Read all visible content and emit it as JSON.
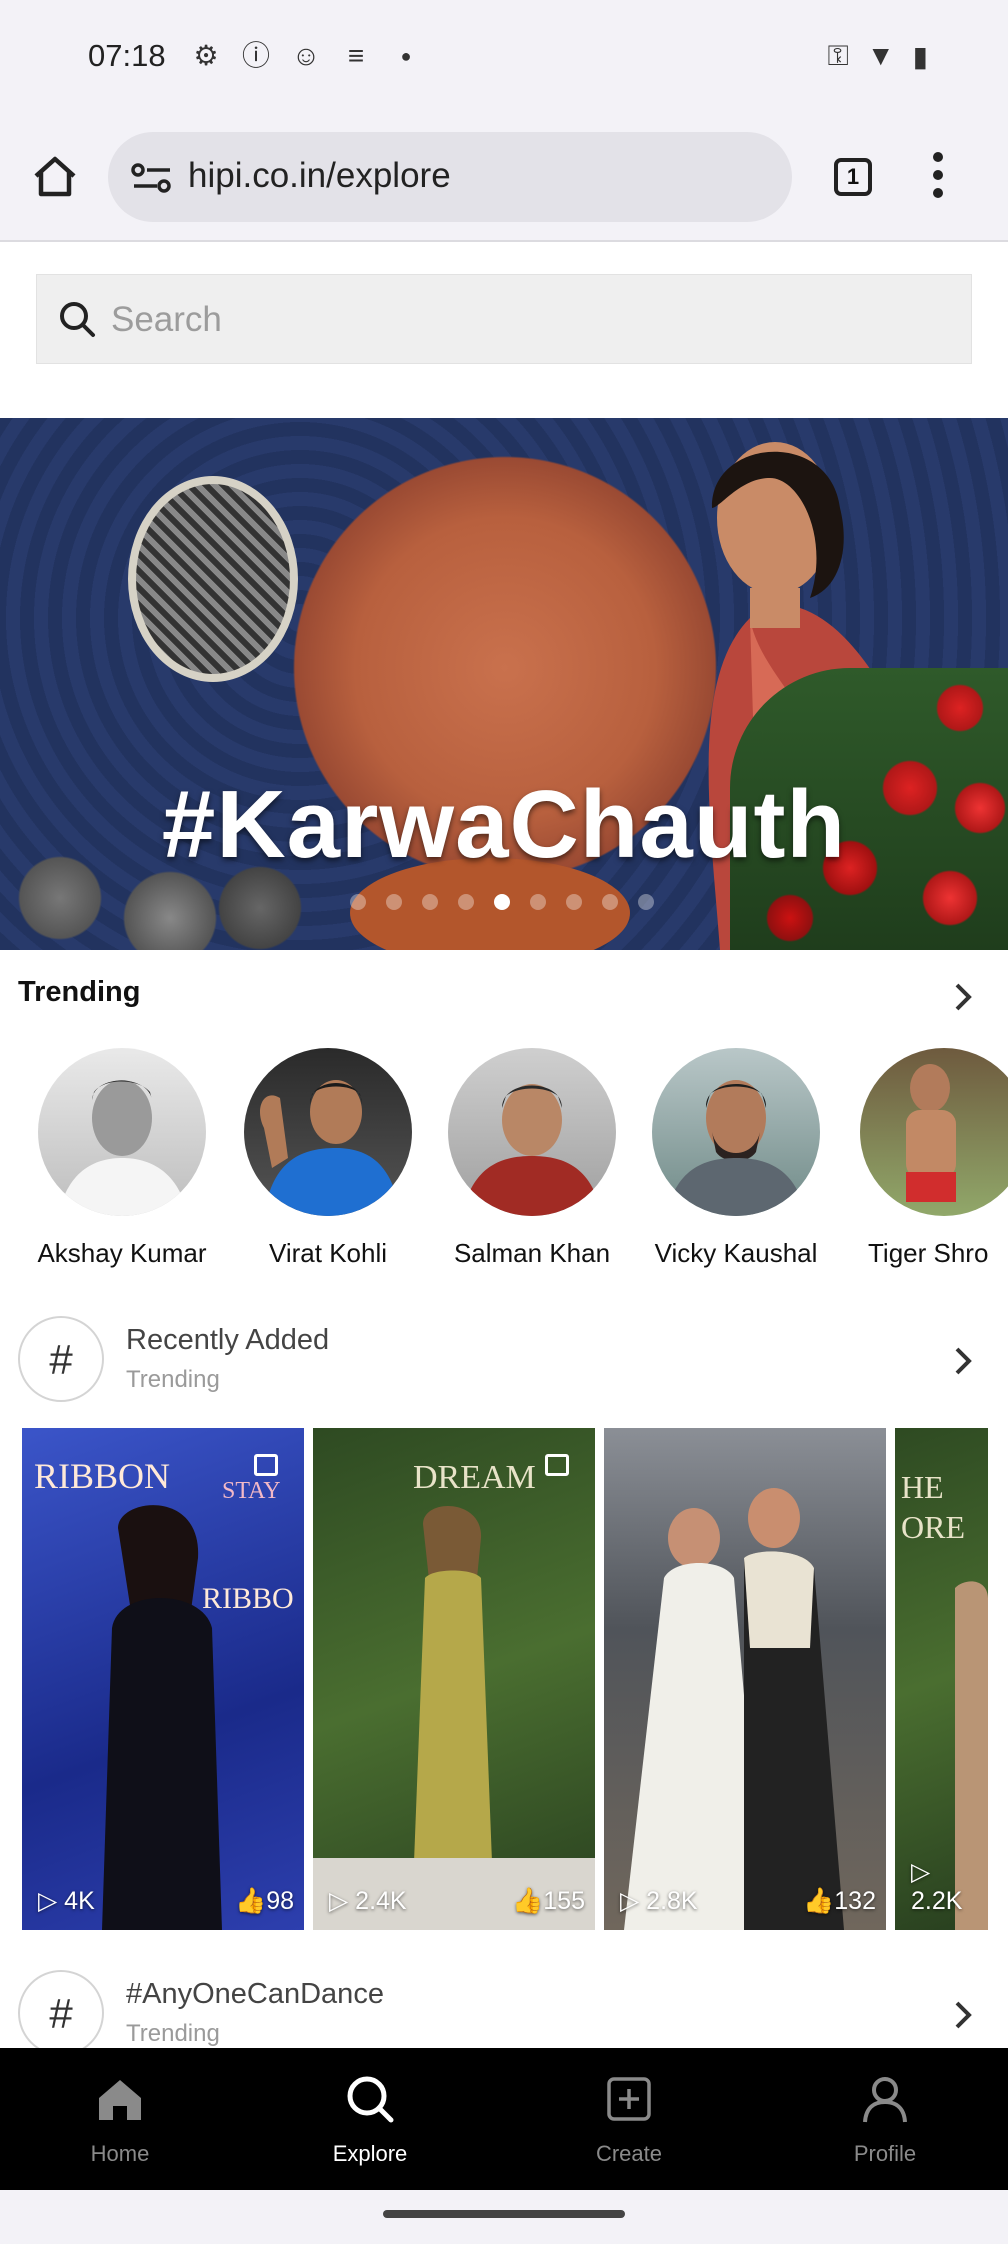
{
  "status_bar": {
    "time": "07:18"
  },
  "browser": {
    "url": "hipi.co.in/explore",
    "tab_count": "1"
  },
  "search": {
    "placeholder": "Search"
  },
  "banner": {
    "hashtag": "#KarwaChauth",
    "slide_count": 9,
    "active_slide": 5
  },
  "trending": {
    "title": "Trending",
    "creators": [
      {
        "name": "Akshay Kumar"
      },
      {
        "name": "Virat Kohli"
      },
      {
        "name": "Salman Khan"
      },
      {
        "name": "Vicky Kaushal"
      },
      {
        "name": "Tiger Shro"
      }
    ]
  },
  "hashtag_sections": [
    {
      "title": "Recently Added",
      "subtitle": "Trending",
      "videos": [
        {
          "views": "4K",
          "likes": "98"
        },
        {
          "views": "2.4K",
          "likes": "155"
        },
        {
          "views": "2.8K",
          "likes": "132"
        },
        {
          "views": "2.2K",
          "likes": ""
        }
      ]
    },
    {
      "title": "#AnyOneCanDance",
      "subtitle": "Trending"
    }
  ],
  "bottom_nav": {
    "items": [
      {
        "label": "Home",
        "icon": "home-icon",
        "active": false
      },
      {
        "label": "Explore",
        "icon": "search-icon",
        "active": true
      },
      {
        "label": "Create",
        "icon": "plus-square-icon",
        "active": false
      },
      {
        "label": "Profile",
        "icon": "person-icon",
        "active": false
      }
    ]
  }
}
